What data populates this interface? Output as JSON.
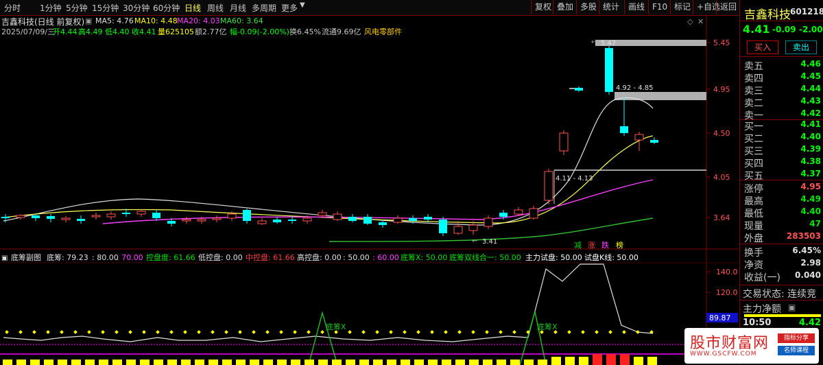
{
  "toolbar": {
    "periods": [
      "分时",
      "1分钟",
      "5分钟",
      "15分钟",
      "30分钟",
      "60分钟",
      "日线",
      "周线",
      "月线",
      "多周期",
      "更多"
    ],
    "active_period": "日线",
    "right_buttons": [
      "复权",
      "叠加",
      "多股",
      "统计",
      "画线",
      "F10",
      "标记",
      "+自选",
      "返回"
    ]
  },
  "stock": {
    "name_period": "吉鑫科技(日线 前复权)",
    "name": "吉鑫科技",
    "code": "601218",
    "price": "4.41",
    "change": "-0.09",
    "change_pct": "-2.00%"
  },
  "ma": {
    "ma5": "MA5: 4.76",
    "ma10": "MA10: 4.48",
    "ma20": "MA20: 4.03",
    "ma60": "MA60: 3.64"
  },
  "quote_line": {
    "date": "2025/07/09/三",
    "open": "开4.44",
    "high": "高4.49",
    "low": "低4.40",
    "close": "收4.41",
    "vol": "量625105",
    "amt": "额2.77亿",
    "range": "幅-0.09(-2.00%)",
    "turnover": "换6.45%",
    "float": "流通9.69亿",
    "sector": "风电零部件"
  },
  "price_axis": [
    "5.45",
    "4.95",
    "4.50",
    "4.05",
    "3.64"
  ],
  "chart_annotations": {
    "high_marker": "5.47",
    "low_marker": "3.41",
    "range_top": "4.92 - 4.85",
    "range_bottom": "4.11 - 4.13",
    "signals": [
      "减",
      "涨",
      "跌",
      "榜"
    ]
  },
  "indicator": {
    "title": "底筹副图",
    "d1": "底筹: 79.23",
    "d2": ": 80.00",
    "d3": ": 70.00",
    "d4": "控盘度: 61.66",
    "d5": "低控盘: 0.00",
    "d6": "中控盘: 61.66",
    "d7": "高控盘: 0.00",
    "d8": ": 50.00",
    "d9": ": 60.00",
    "d10": "底筹X: 50.00",
    "d11": "底筹双线合一: 50.00",
    "d12": "主力试盘: 50.00",
    "d13": "试盘K线: 50.00",
    "axis": [
      "140.0",
      "120.0"
    ],
    "current": "89.87",
    "tag": "底筹X"
  },
  "orderbook": {
    "buy_btn": "买入",
    "sell_btn": "卖出",
    "asks": [
      {
        "label": "卖五",
        "price": "4.46"
      },
      {
        "label": "卖四",
        "price": "4.45"
      },
      {
        "label": "卖三",
        "price": "4.44"
      },
      {
        "label": "卖二",
        "price": "4.43"
      },
      {
        "label": "卖一",
        "price": "4.42"
      }
    ],
    "bids": [
      {
        "label": "买一",
        "price": "4.41"
      },
      {
        "label": "买二",
        "price": "4.40"
      },
      {
        "label": "买三",
        "price": "4.39"
      },
      {
        "label": "买四",
        "price": "4.38"
      },
      {
        "label": "买五",
        "price": "4.37"
      }
    ]
  },
  "stats": [
    {
      "label": "涨停",
      "value": "4.95",
      "color": "#ff5454"
    },
    {
      "label": "最高",
      "value": "4.49",
      "color": "#00e600"
    },
    {
      "label": "最低",
      "value": "4.40",
      "color": "#00e600"
    },
    {
      "label": "现量",
      "value": "47",
      "color": "#00e600"
    },
    {
      "label": "外盘",
      "value": "283503",
      "color": "#ff5454"
    },
    {
      "label": "换手",
      "value": "6.45%",
      "color": "#e0e0e0"
    },
    {
      "label": "净资",
      "value": "2.98",
      "color": "#e0e0e0"
    },
    {
      "label": "收益(一)",
      "value": "0.040",
      "color": "#e0e0e0"
    }
  ],
  "trade_state": "交易状态: 连续竞",
  "net_flow": "主力净额",
  "last_tick": {
    "time": "10:50",
    "price": "4.42"
  },
  "watermark": {
    "title": "股市财富网",
    "url": "WWW.GSCFW.COM",
    "badge1": "指标分享",
    "badge2": "名师课程"
  },
  "colors": {
    "up": "#ff5454",
    "down": "#00ffff",
    "border": "#800000",
    "yellow": "#ffff00",
    "magenta": "#ff00ff"
  }
}
